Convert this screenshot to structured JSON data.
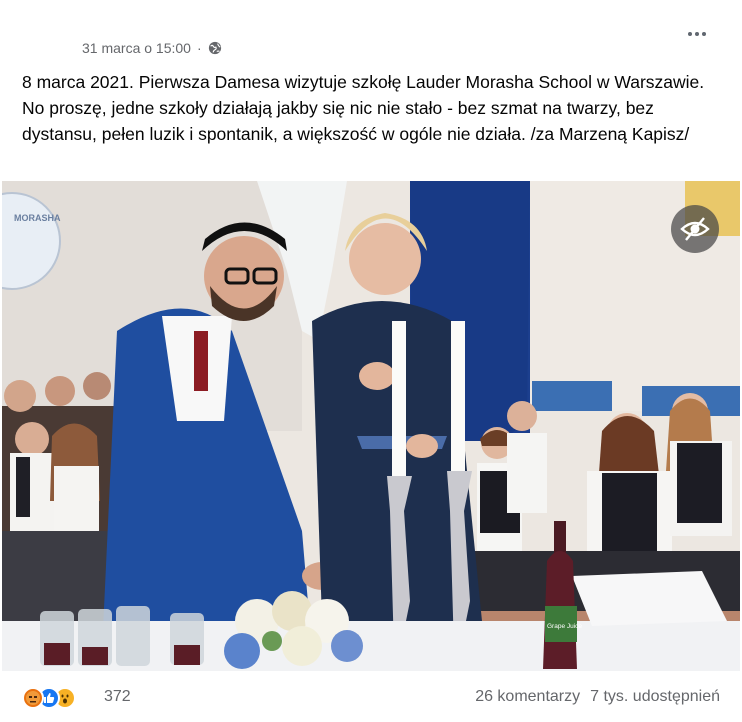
{
  "post": {
    "timestamp": "31 marca o 15:00",
    "separator": "·",
    "privacy_icon": "globe-icon",
    "more_icon": "more-options-icon",
    "text": "8 marca 2021. Pierwsza Damesa wizytuje szkołę Lauder Morasha School w Warszawie. No proszę, jedne szkoły działają jakby się nic nie stało - bez szmat na twarzy, bez dystansu, pełen luzik i spontanik, a większość w ogóle nie działa. /za Marzeną Kapisz/"
  },
  "photo": {
    "hide_icon": "eye-slash-icon",
    "wall_logo_text": "MORASHA",
    "bottle_label": "Grape Juice"
  },
  "footer": {
    "reaction_icons": [
      "angry-reaction-icon",
      "like-reaction-icon",
      "wow-reaction-icon"
    ],
    "reaction_count": "372",
    "comments": "26 komentarzy",
    "shares": "7 tys. udostępnień"
  },
  "colors": {
    "text_primary": "#050505",
    "text_secondary": "#65676b",
    "like_blue": "#1877f2",
    "angry_orange": "#e9710f",
    "wow_yellow": "#f7b125"
  }
}
